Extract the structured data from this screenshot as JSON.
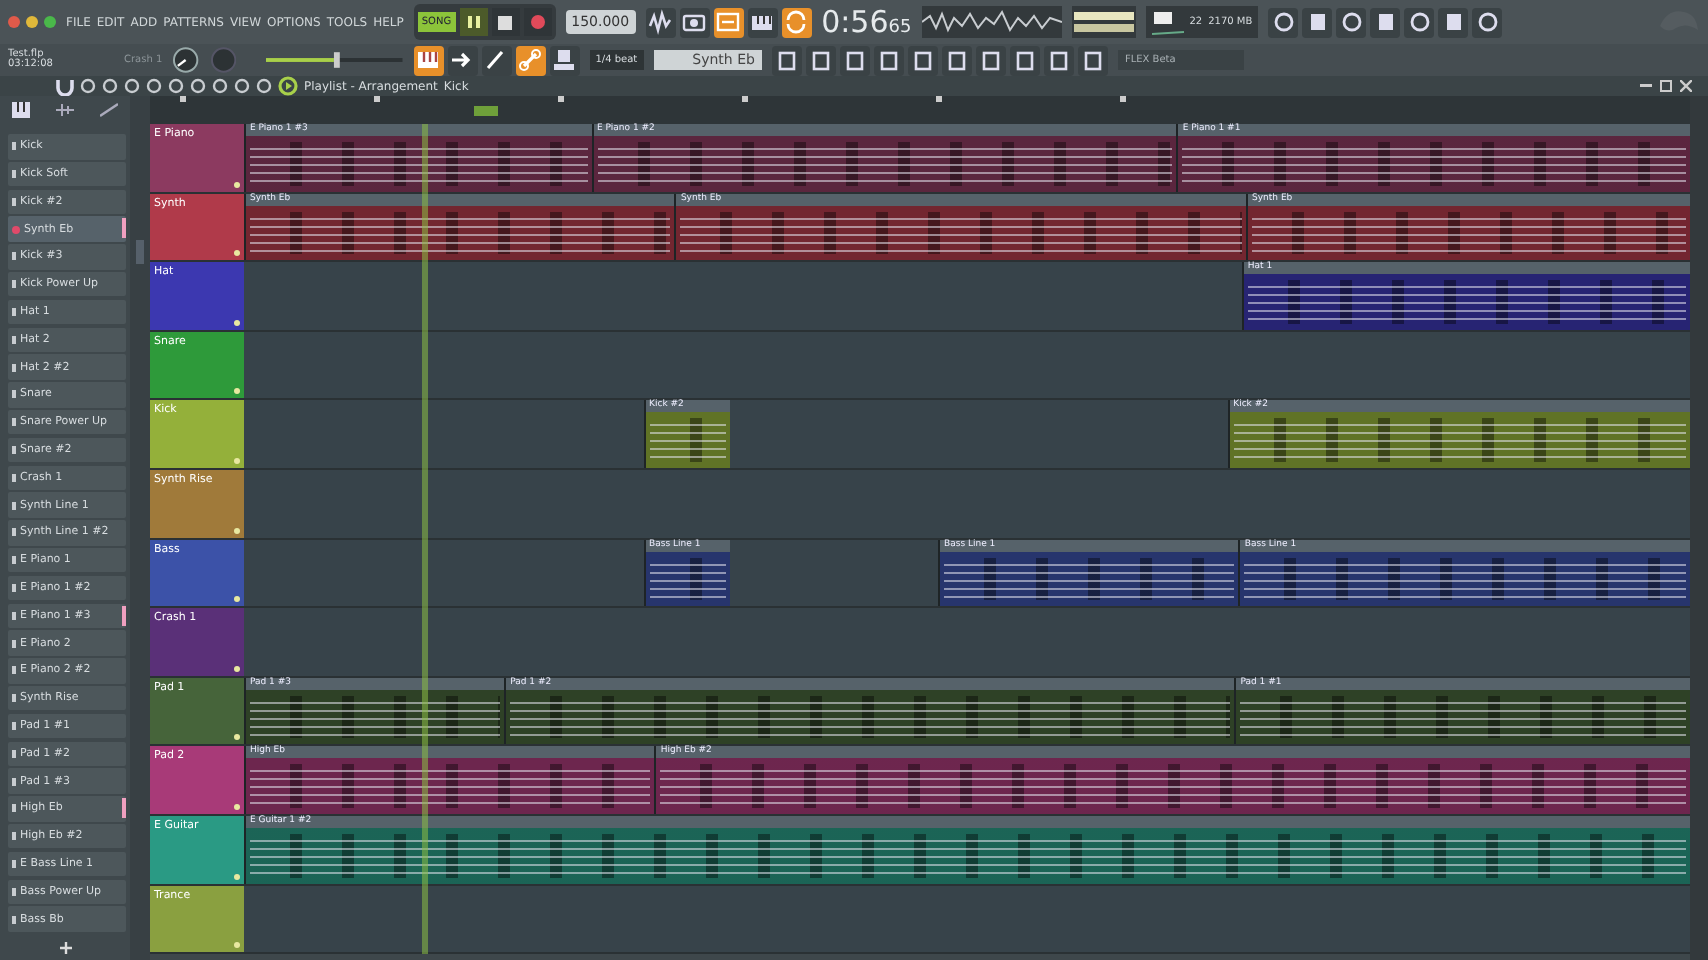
{
  "menu": [
    "FILE",
    "EDIT",
    "ADD",
    "PATTERNS",
    "VIEW",
    "OPTIONS",
    "TOOLS",
    "HELP"
  ],
  "transport": {
    "mode_label": "SONG",
    "playing": true,
    "tempo": "150.000",
    "time": "0:56",
    "time_fraction": "65",
    "cpu": "22",
    "memory": "2170 MB"
  },
  "toolbar_top": [
    {
      "on": false
    },
    {
      "on": false
    },
    {
      "on": true
    },
    {
      "on": false
    },
    {
      "on": true
    }
  ],
  "project": {
    "file": "Test.flp",
    "time": "03:12:08",
    "hint": "Crash 1"
  },
  "master_volume": {
    "level": 0.52
  },
  "toolbar_second": [
    {
      "on": true
    },
    {
      "on": false
    },
    {
      "on": false
    },
    {
      "on": true
    },
    {
      "on": false
    }
  ],
  "snap": "1/4 beat",
  "current_pattern": "Synth Eb",
  "plugin_preset": "FLEX Beta",
  "playlist": {
    "title": "Playlist - Arrangement",
    "breadcrumb": "Kick"
  },
  "patterns": [
    {
      "name": "Kick",
      "selected": false,
      "flagged": false
    },
    {
      "name": "Kick Soft",
      "selected": false,
      "flagged": false
    },
    {
      "name": "Kick #2",
      "selected": false,
      "flagged": false
    },
    {
      "name": "Synth Eb",
      "selected": true,
      "flagged": true
    },
    {
      "name": "Kick #3",
      "selected": false,
      "flagged": false
    },
    {
      "name": "Kick Power Up",
      "selected": false,
      "flagged": false
    },
    {
      "name": "Hat 1",
      "selected": false,
      "flagged": false
    },
    {
      "name": "Hat 2",
      "selected": false,
      "flagged": false
    },
    {
      "name": "Hat 2 #2",
      "selected": false,
      "flagged": false
    },
    {
      "name": "Snare",
      "selected": false,
      "flagged": false
    },
    {
      "name": "Snare Power Up",
      "selected": false,
      "flagged": false
    },
    {
      "name": "Snare #2",
      "selected": false,
      "flagged": false
    },
    {
      "name": "Crash 1",
      "selected": false,
      "flagged": false
    },
    {
      "name": "Synth Line 1",
      "selected": false,
      "flagged": false
    },
    {
      "name": "Synth Line 1 #2",
      "selected": false,
      "flagged": false
    },
    {
      "name": "E Piano 1",
      "selected": false,
      "flagged": false
    },
    {
      "name": "E Piano 1 #2",
      "selected": false,
      "flagged": false
    },
    {
      "name": "E Piano 1 #3",
      "selected": false,
      "flagged": true
    },
    {
      "name": "E Piano 2",
      "selected": false,
      "flagged": false
    },
    {
      "name": "E Piano 2 #2",
      "selected": false,
      "flagged": false
    },
    {
      "name": "Synth Rise",
      "selected": false,
      "flagged": false
    },
    {
      "name": "Pad 1 #1",
      "selected": false,
      "flagged": false
    },
    {
      "name": "Pad 1 #2",
      "selected": false,
      "flagged": false
    },
    {
      "name": "Pad 1 #3",
      "selected": false,
      "flagged": false
    },
    {
      "name": "High Eb",
      "selected": false,
      "flagged": true
    },
    {
      "name": "High Eb #2",
      "selected": false,
      "flagged": false
    },
    {
      "name": "E Bass Line 1",
      "selected": false,
      "flagged": false
    },
    {
      "name": "Bass Power Up",
      "selected": false,
      "flagged": false
    },
    {
      "name": "Bass Bb",
      "selected": false,
      "flagged": false
    }
  ],
  "tracks": [
    {
      "name": "E Piano",
      "color": "#8c3a60",
      "clips": [
        "E Piano 1 #3",
        "E Piano 1 #2",
        "E Piano 1 #1"
      ]
    },
    {
      "name": "Synth",
      "color": "#b03a4a",
      "clips": [
        "Synth Eb",
        "Synth Eb",
        "Synth Eb"
      ]
    },
    {
      "name": "Hat",
      "color": "#3c38b0",
      "clips": [
        "Hat 1"
      ]
    },
    {
      "name": "Snare",
      "color": "#2e9a3a"
    },
    {
      "name": "Kick",
      "color": "#94b03a",
      "clips": [
        "Kick #2",
        "Kick #2"
      ]
    },
    {
      "name": "Synth Rise",
      "color": "#a07a3a"
    },
    {
      "name": "Bass",
      "color": "#3c52a8",
      "clips": [
        "Bass Line 1",
        "Bass Line 1",
        "Bass Line 1"
      ]
    },
    {
      "name": "Crash 1",
      "color": "#5a3078"
    },
    {
      "name": "Pad 1",
      "color": "#46643a",
      "clips": [
        "Pad 1 #3",
        "Pad 1 #2",
        "Pad 1 #1"
      ]
    },
    {
      "name": "Pad 2",
      "color": "#a83a78",
      "clips": [
        "High Eb",
        "High Eb #2"
      ]
    },
    {
      "name": "E Guitar",
      "color": "#2a9a84",
      "clips": [
        "E Guitar 1 #2"
      ]
    },
    {
      "name": "Trance",
      "color": "#8aa040"
    }
  ]
}
